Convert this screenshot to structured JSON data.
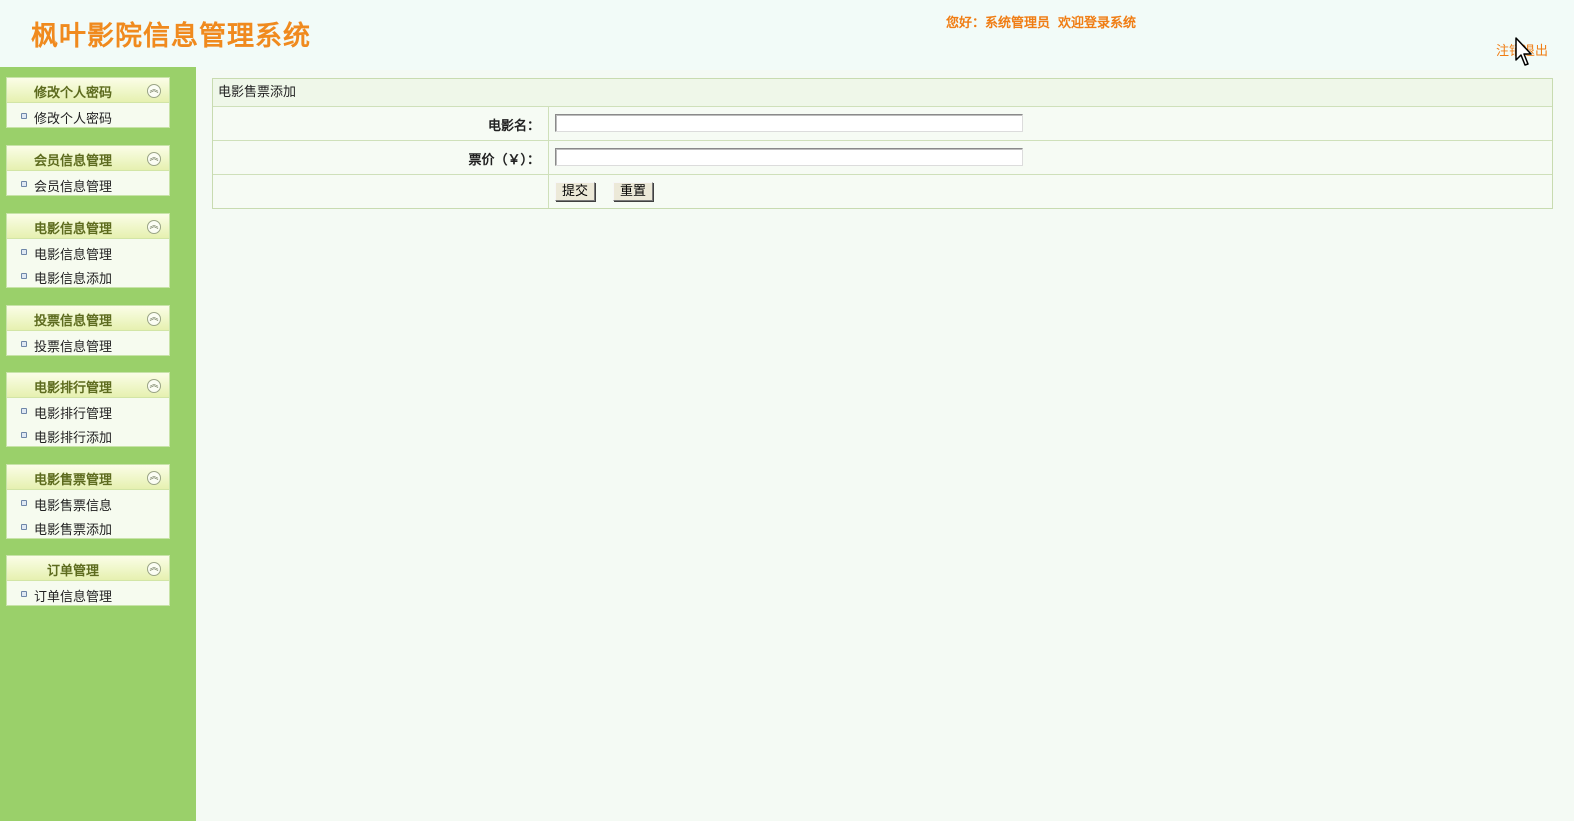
{
  "header": {
    "title": "枫叶影院信息管理系统",
    "greeting": "您好：系统管理员",
    "welcome": "欢迎登录系统",
    "logout": "注销退出"
  },
  "sidebar": {
    "groups": [
      {
        "title": "修改个人密码",
        "items": [
          "修改个人密码"
        ]
      },
      {
        "title": "会员信息管理",
        "items": [
          "会员信息管理"
        ]
      },
      {
        "title": "电影信息管理",
        "items": [
          "电影信息管理",
          "电影信息添加"
        ]
      },
      {
        "title": "投票信息管理",
        "items": [
          "投票信息管理"
        ]
      },
      {
        "title": "电影排行管理",
        "items": [
          "电影排行管理",
          "电影排行添加"
        ]
      },
      {
        "title": "电影售票管理",
        "items": [
          "电影售票信息",
          "电影售票添加"
        ]
      },
      {
        "title": "订单管理",
        "items": [
          "订单信息管理"
        ]
      }
    ]
  },
  "main": {
    "panel_title": "电影售票添加",
    "fields": [
      {
        "label": "电影名：",
        "value": ""
      },
      {
        "label": "票价（￥）：",
        "value": ""
      }
    ],
    "submit_label": "提交",
    "reset_label": "重置"
  },
  "colors": {
    "accent": "#f07d14",
    "sidebar_bg": "#9ad06a"
  }
}
